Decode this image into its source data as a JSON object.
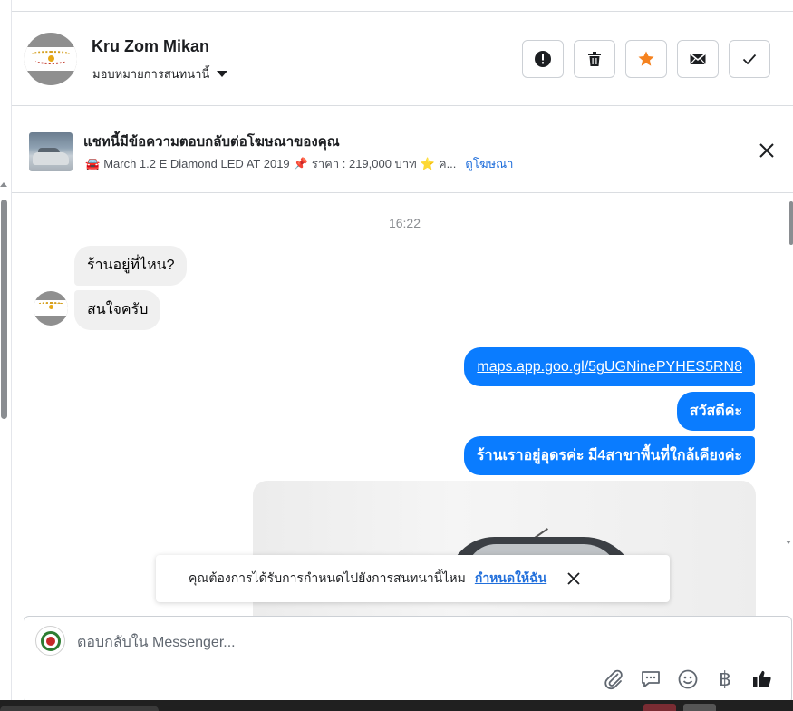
{
  "header": {
    "contact_name": "Kru Zom Mikan",
    "assign_label": "มอบหมายการสนทนานี้",
    "actions": [
      {
        "name": "spam",
        "icon": "exclamation-icon"
      },
      {
        "name": "delete",
        "icon": "trash-icon"
      },
      {
        "name": "star",
        "icon": "star-icon",
        "color": "#f5821f"
      },
      {
        "name": "mark-unread",
        "icon": "envelope-icon"
      },
      {
        "name": "mark-done",
        "icon": "check-icon"
      }
    ]
  },
  "ad_banner": {
    "title": "แชทนี้มีข้อความตอบกลับต่อโฆษณาของคุณ",
    "car_emoji": "🚘",
    "pin_emoji": "📌",
    "star_emoji": "⭐",
    "description_part1": "March 1.2 E Diamond LED AT 2019",
    "description_part2": "ราคา : 219,000 บาท",
    "description_part3": "ค...",
    "view_ad_link": "ดูโฆษณา"
  },
  "chat": {
    "timestamp": "16:22",
    "incoming": [
      {
        "text": "ร้านอยู่ที่ไหน?"
      },
      {
        "text": "สนใจครับ"
      }
    ],
    "outgoing": [
      {
        "text": "maps.app.goo.gl/5gUGNinePYHES5RN8",
        "is_link": true
      },
      {
        "text": "สวัสดีค่ะ"
      },
      {
        "text": "ร้านเราอยู่อุดรค่ะ มี4สาขาพื้นที่ใกล้เคียงค่ะ"
      }
    ]
  },
  "assign_prompt": {
    "text": "คุณต้องการได้รับการกำหนดไปยังการสนทนานี้ไหม",
    "link": "กำหนดให้ฉัน"
  },
  "composer": {
    "placeholder": "ตอบกลับใน Messenger...",
    "tools": [
      "paperclip-icon",
      "saved-reply-icon",
      "emoji-icon",
      "baht-icon",
      "thumbs-up-icon"
    ],
    "baht_symbol": "฿"
  },
  "colors": {
    "accent_blue": "#0a7cff",
    "link_blue": "#216fdb",
    "star_orange": "#f5821f"
  }
}
